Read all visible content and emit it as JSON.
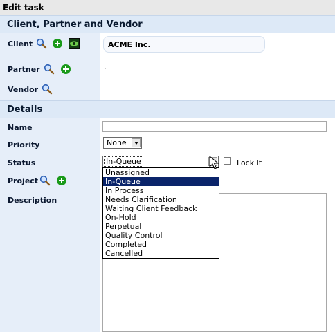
{
  "title": "Edit task",
  "sections": {
    "client_partner_vendor": "Client, Partner and Vendor",
    "details": "Details"
  },
  "labels": {
    "client": "Client",
    "partner": "Partner",
    "vendor": "Vendor",
    "name": "Name",
    "priority": "Priority",
    "status": "Status",
    "project": "Project",
    "description": "Description"
  },
  "client_value": "ACME Inc.",
  "name_value": "",
  "priority": {
    "selected": "None"
  },
  "status": {
    "selected": "In-Queue",
    "options": [
      "Unassigned",
      "In-Queue",
      "In Process",
      "Needs Clarification",
      "Waiting Client Feedback",
      "On-Hold",
      "Perpetual",
      "Quality Control",
      "Completed",
      "Cancelled"
    ],
    "highlighted": "In-Queue"
  },
  "lock_label": "Lock It",
  "colors": {
    "section_bg": "#dde9f7",
    "label_bg": "#e6eef9",
    "highlight": "#0a246a",
    "add_green": "#1a9a1a"
  },
  "icons": {
    "search": "magnifier-icon",
    "add": "plus-circle-icon",
    "view": "eye-icon"
  }
}
